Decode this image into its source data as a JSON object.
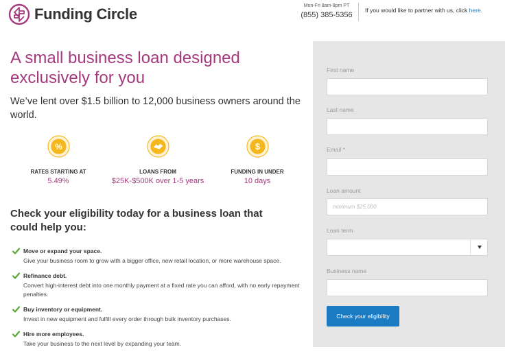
{
  "header": {
    "brand_name": "Funding Circle",
    "phone_hours": "Mon-Fri 8am-8pm PT",
    "phone_number": "(855) 385-5356",
    "partner_text": "If you would like to partner with us, click ",
    "partner_link": "here."
  },
  "hero": {
    "headline": "A small business loan designed exclusively for you",
    "subheadline": "We’ve lent over $1.5 billion to 12,000 business owners around the world."
  },
  "features": [
    {
      "icon": "percent-icon",
      "title": "RATES STARTING AT",
      "value": "5.49%"
    },
    {
      "icon": "handshake-icon",
      "title": "LOANS FROM",
      "value": "$25K-$500K over 1-5 years"
    },
    {
      "icon": "dollar-coin-icon",
      "title": "FUNDING IN UNDER",
      "value": "10 days"
    }
  ],
  "eligibility": {
    "title": "Check your eligibility today for a business loan that could help you:",
    "items": [
      {
        "title": "Move or expand your space.",
        "desc": "Give your business room to grow with a bigger office, new retail location, or more warehouse space."
      },
      {
        "title": "Refinance debt.",
        "desc": "Convert high-interest debt into one monthly payment at a fixed rate you can afford, with no early repayment penalties."
      },
      {
        "title": "Buy inventory or equipment.",
        "desc": "Invest in new equipment and fulfill every order through bulk inventory purchases."
      },
      {
        "title": "Hire more employees.",
        "desc": "Take your business to the next level by expanding your team."
      }
    ]
  },
  "form": {
    "first_name_label": "First name",
    "last_name_label": "Last name",
    "email_label": "Email *",
    "loan_amount_label": "Loan amount",
    "loan_amount_placeholder": "minimum $25,000",
    "loan_term_label": "Loan term",
    "loan_term_value": "",
    "business_name_label": "Business name",
    "submit_label": "Check your eligibility"
  },
  "colors": {
    "brand_purple": "#a6397e",
    "accent_yellow": "#f5b71e",
    "button_blue": "#1a7ac2",
    "check_green": "#5aa53c",
    "panel_gray": "#e6e6e6"
  }
}
